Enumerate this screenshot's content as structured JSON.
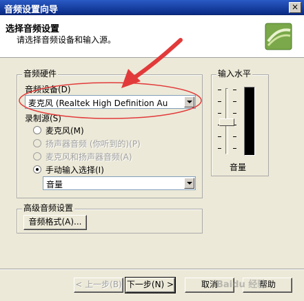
{
  "window": {
    "title": "音频设置向导",
    "close_glyph": "×"
  },
  "header": {
    "title": "选择音频设置",
    "subtitle": "请选择音频设备和输入源。"
  },
  "hardware": {
    "group_label": "音频硬件",
    "device_label": "音频设备(D)",
    "device_value": "麦克风 (Realtek High Definition Au",
    "source_label": "录制源(S)",
    "sources": [
      {
        "label": "麦克风(M)",
        "checked": false,
        "enabled": true
      },
      {
        "label": "扬声器音频 (你听到的)(P)",
        "checked": false,
        "enabled": false
      },
      {
        "label": "麦克风和扬声器音频(A)",
        "checked": false,
        "enabled": false
      },
      {
        "label": "手动输入选择(I)",
        "checked": true,
        "enabled": true
      }
    ],
    "manual_input_value": "音量"
  },
  "input_level": {
    "group_label": "输入水平",
    "volume_label": "音量"
  },
  "advanced": {
    "group_label": "高级音频设置",
    "format_button": "音频格式(A)..."
  },
  "footer": {
    "back": "< 上一步(B)",
    "next": "下一步(N) >",
    "cancel": "取消",
    "help": "帮助"
  },
  "colors": {
    "annotation_red": "#e23a3a",
    "title_blue": "#1b45a8"
  }
}
